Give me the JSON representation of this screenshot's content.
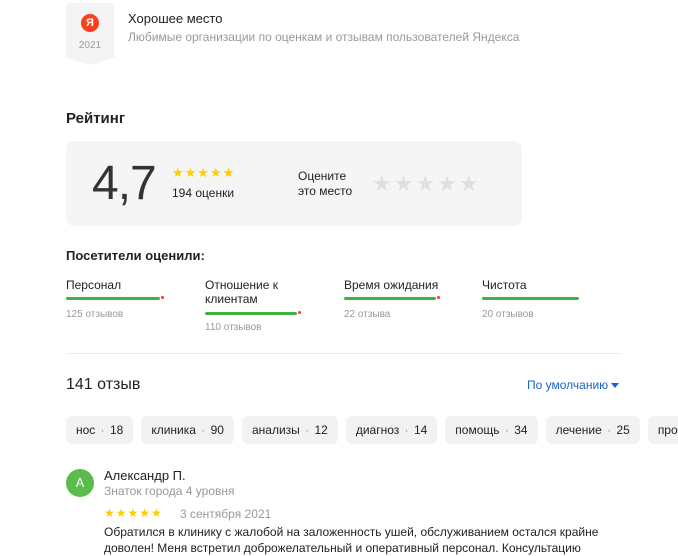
{
  "good_place": {
    "logo_letter": "Я",
    "year": "2021",
    "title": "Хорошее место",
    "subtitle": "Любимые организации по оценкам и отзывам пользователей Яндекса"
  },
  "rating": {
    "heading": "Рейтинг",
    "value": "4,7",
    "stars_text": "★★★★★",
    "star_color": "#ffcc00",
    "count": "194 оценки",
    "rate_prompt_line1": "Оцените",
    "rate_prompt_line2": "это место",
    "empty_stars": "★★★★★"
  },
  "aspects": {
    "heading": "Посетители оценили:",
    "accent_color": "#3db343",
    "items": [
      {
        "label": "Персонал",
        "count": "125 отзывов"
      },
      {
        "label": "Отношение к клиентам",
        "count": "110 отзывов"
      },
      {
        "label": "Время ожидания",
        "count": "22 отзыва"
      },
      {
        "label": "Чистота",
        "count": "20 отзывов"
      }
    ]
  },
  "reviews_header": {
    "count": "141 отзыв",
    "sort_label": "По умолчанию",
    "sort_color": "#1a62cc"
  },
  "tags": [
    {
      "label": "нос",
      "count": "18"
    },
    {
      "label": "клиника",
      "count": "90"
    },
    {
      "label": "анализы",
      "count": "12"
    },
    {
      "label": "диагноз",
      "count": "14"
    },
    {
      "label": "помощь",
      "count": "34"
    },
    {
      "label": "лечение",
      "count": "25"
    },
    {
      "label": "пробле",
      "count": ""
    }
  ],
  "review": {
    "avatar_letter": "А",
    "avatar_color": "#5abc4a",
    "author": "Александр П.",
    "rank": "Знаток города 4 уровня",
    "stars_text": "★★★★★",
    "date": "3 сентября 2021",
    "text": "Обратился в клинику с жалобой на заложенность ушей, обслуживанием остался крайне доволен! Меня встретил доброжелательный и оперативный персонал. Консультацию"
  }
}
